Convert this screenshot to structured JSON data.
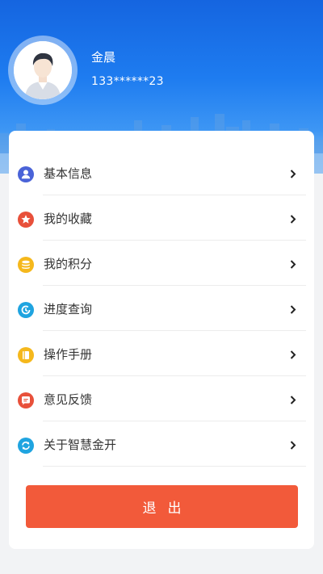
{
  "profile": {
    "name": "金晨",
    "phone": "133******23"
  },
  "menu": [
    {
      "label": "基本信息",
      "icon": "user-icon",
      "color": "#4a63d8"
    },
    {
      "label": "我的收藏",
      "icon": "star-icon",
      "color": "#e8503a"
    },
    {
      "label": "我的积分",
      "icon": "coins-icon",
      "color": "#f5b81c"
    },
    {
      "label": "进度查询",
      "icon": "progress-icon",
      "color": "#1fa4e0"
    },
    {
      "label": "操作手册",
      "icon": "book-icon",
      "color": "#f5b81c"
    },
    {
      "label": "意见反馈",
      "icon": "feedback-icon",
      "color": "#e8503a"
    },
    {
      "label": "关于智慧金开",
      "icon": "refresh-icon",
      "color": "#1fa4e0"
    }
  ],
  "logout": {
    "label": "退出",
    "color": "#f25a3a"
  }
}
